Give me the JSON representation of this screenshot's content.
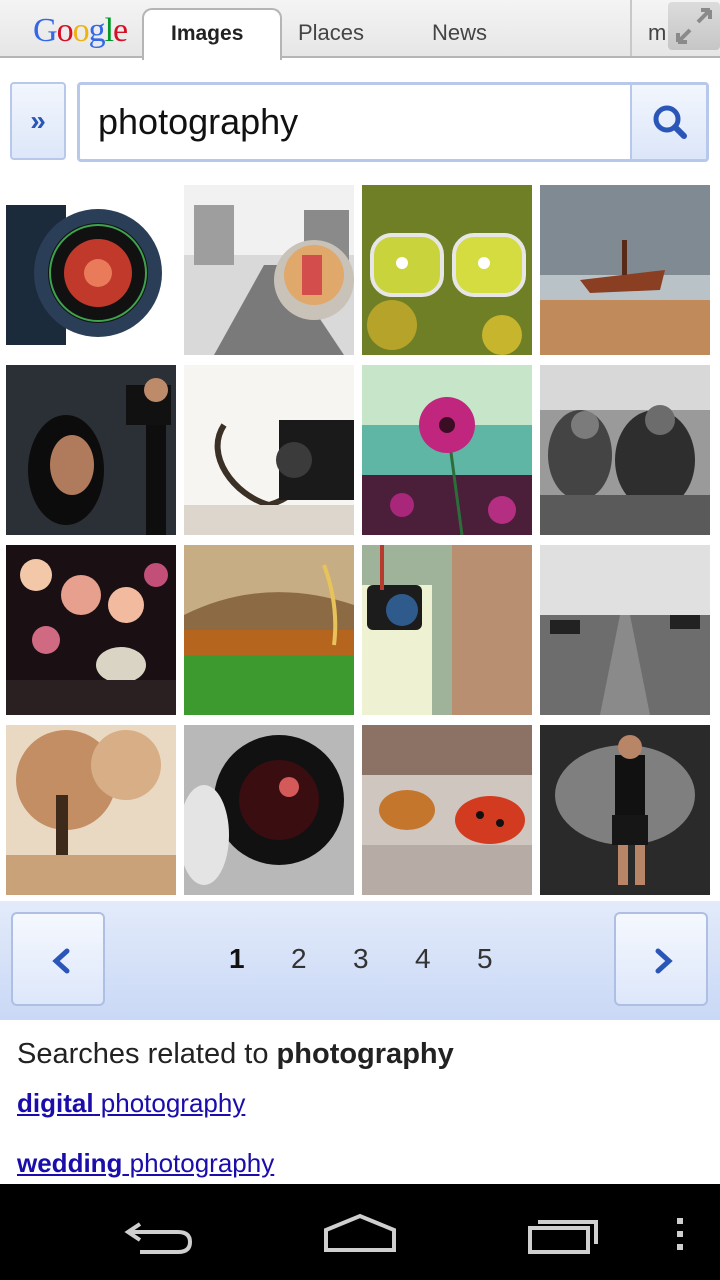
{
  "header": {
    "logo_text": "Google",
    "tabs": [
      {
        "label": "Images",
        "active": true
      },
      {
        "label": "Places",
        "active": false
      },
      {
        "label": "News",
        "active": false
      }
    ],
    "more_label": "m",
    "expand_icon": "expand-arrows-icon"
  },
  "search": {
    "menu_label": "»",
    "query": "photography",
    "search_icon": "search-icon"
  },
  "results": [
    {
      "subject": "camera lens close-up"
    },
    {
      "subject": "street with lens reflection"
    },
    {
      "subject": "glasses over yellow flowers"
    },
    {
      "subject": "shipwreck on beach"
    },
    {
      "subject": "woman photographed by photographer"
    },
    {
      "subject": "book pages heart and camera"
    },
    {
      "subject": "pink poppy flower"
    },
    {
      "subject": "group of people black and white"
    },
    {
      "subject": "bokeh lights"
    },
    {
      "subject": "green field with rainbow"
    },
    {
      "subject": "camera hanging on person"
    },
    {
      "subject": "pier with benches"
    },
    {
      "subject": "autumn tree"
    },
    {
      "subject": "hand holding lens"
    },
    {
      "subject": "two ladybugs"
    },
    {
      "subject": "rugby player"
    }
  ],
  "pagination": {
    "prev_icon": "chevron-left-icon",
    "next_icon": "chevron-right-icon",
    "pages": [
      "1",
      "2",
      "3",
      "4",
      "5"
    ],
    "current": "1"
  },
  "related": {
    "title_prefix": "Searches related to ",
    "title_query": "photography",
    "links": [
      {
        "bold": "digital",
        "rest": " photography"
      },
      {
        "bold": "wedding",
        "rest": " photography"
      }
    ]
  },
  "system_nav": {
    "back_icon": "back-icon",
    "home_icon": "home-icon",
    "recents_icon": "recent-apps-icon",
    "menu_icon": "overflow-menu-icon"
  },
  "colors": {
    "link": "#1a0dab",
    "accent": "#2a56b8",
    "pager_bg": "#c9d8f6"
  }
}
